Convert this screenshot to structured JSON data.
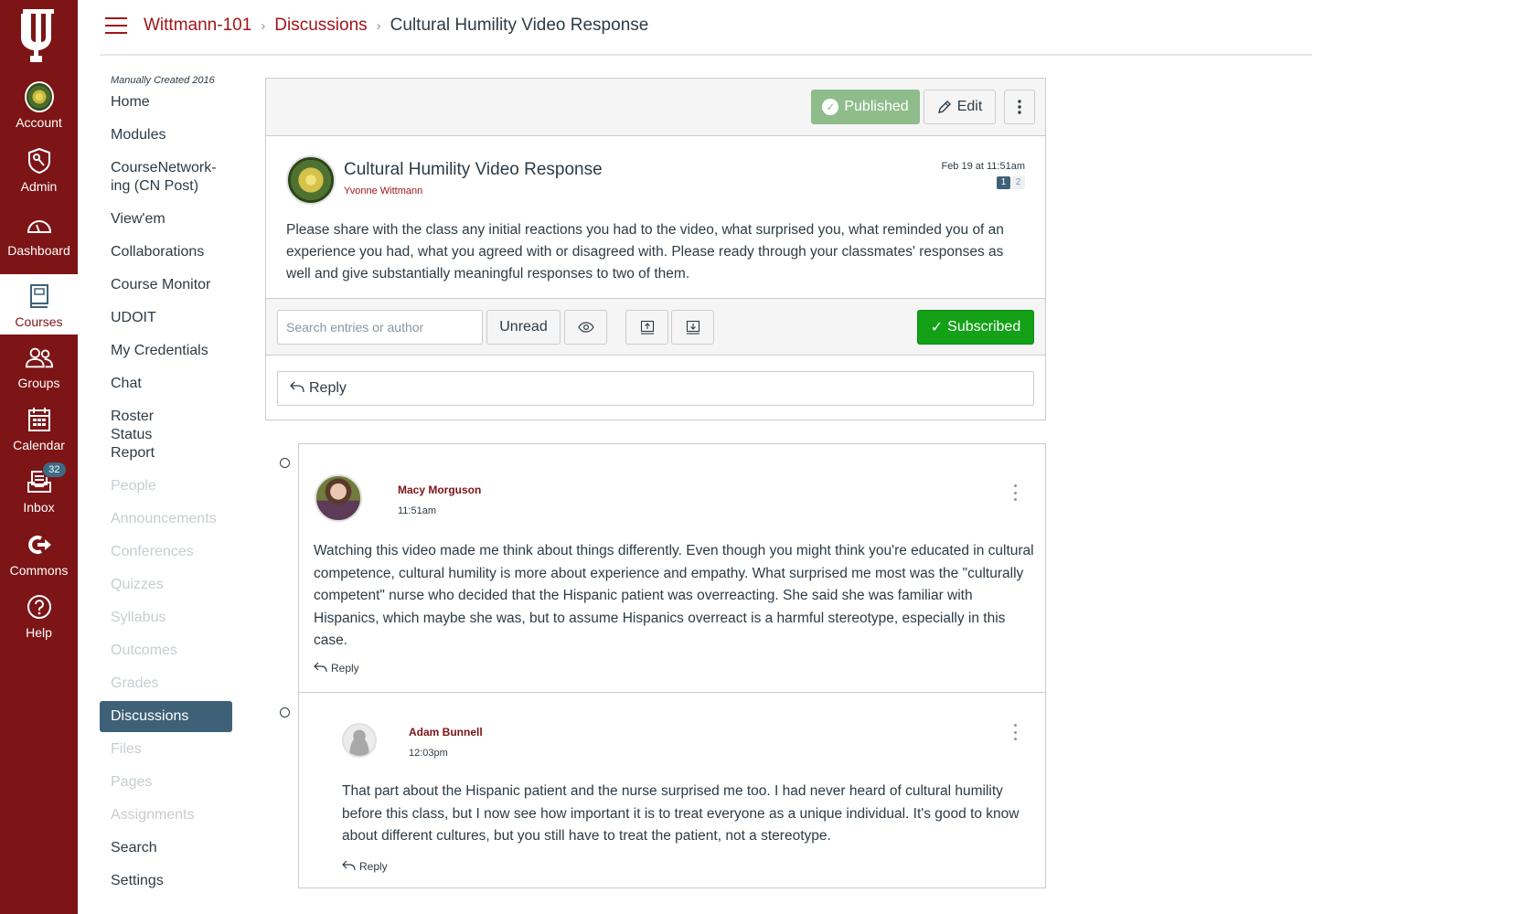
{
  "global_nav": {
    "items": [
      {
        "label": "Account",
        "icon": "account-avatar-icon"
      },
      {
        "label": "Admin",
        "icon": "admin-shield-icon"
      },
      {
        "label": "Dashboard",
        "icon": "dashboard-gauge-icon"
      },
      {
        "label": "Courses",
        "icon": "courses-book-icon",
        "active": true
      },
      {
        "label": "Groups",
        "icon": "groups-icon"
      },
      {
        "label": "Calendar",
        "icon": "calendar-icon"
      },
      {
        "label": "Inbox",
        "icon": "inbox-icon",
        "badge": "32"
      },
      {
        "label": "Commons",
        "icon": "commons-icon"
      },
      {
        "label": "Help",
        "icon": "help-icon"
      }
    ]
  },
  "breadcrumb": {
    "course": "Wittmann-101",
    "section": "Discussions",
    "current": "Cultural Humility Video Response"
  },
  "course_nav": {
    "subtitle": "Manually Created 2016",
    "items": [
      {
        "label": "Home"
      },
      {
        "label": "Modules"
      },
      {
        "label": "CourseNetwork-ing (CN Post)"
      },
      {
        "label": "View'em"
      },
      {
        "label": "Collaborations"
      },
      {
        "label": "Course Monitor"
      },
      {
        "label": "UDOIT"
      },
      {
        "label": "My Credentials"
      },
      {
        "label": "Chat"
      },
      {
        "label": "Roster Status Report"
      },
      {
        "label": "People",
        "disabled": true
      },
      {
        "label": "Announcements",
        "disabled": true
      },
      {
        "label": "Conferences",
        "disabled": true
      },
      {
        "label": "Quizzes",
        "disabled": true
      },
      {
        "label": "Syllabus",
        "disabled": true
      },
      {
        "label": "Outcomes",
        "disabled": true
      },
      {
        "label": "Grades",
        "disabled": true
      },
      {
        "label": "Discussions",
        "active": true
      },
      {
        "label": "Files",
        "disabled": true
      },
      {
        "label": "Pages",
        "disabled": true
      },
      {
        "label": "Assignments",
        "disabled": true
      },
      {
        "label": "Search"
      },
      {
        "label": "Settings"
      }
    ]
  },
  "toolbar": {
    "published_label": "Published",
    "edit_label": "Edit"
  },
  "topic": {
    "title": "Cultural Humility Video Response",
    "author": "Yvonne Wittmann",
    "date": "Feb 19 at 11:51am",
    "pages": [
      "1",
      "2"
    ],
    "body": "Please share with the class any initial reactions you had to the video, what surprised you, what reminded you of an experience you had, what you agreed with or disagreed with. Please ready through your classmates' responses as well and give substantially meaningful responses to two of them."
  },
  "filters": {
    "search_placeholder": "Search entries or author",
    "unread_label": "Unread",
    "subscribed_label": "Subscribed",
    "reply_label": "Reply"
  },
  "entries": [
    {
      "author": "Macy Morguson",
      "time": "11:51am",
      "body": "Watching this video made me think about things differently. Even though you might think you're educated in cultural competence, cultural humility is more about experience and empathy. What surprised me most was the \"culturally competent\" nurse who decided that the Hispanic patient was overreacting. She said she was familiar with Hispanics, which maybe she was, but to assume Hispanics overreact is a harmful stereotype, especially in this case.",
      "reply_label": "Reply"
    },
    {
      "author": "Adam Bunnell",
      "time": "12:03pm",
      "body": "That part about the Hispanic patient and the nurse surprised me too. I had never heard of cultural humility before this class, but I now see how important it is to treat everyone as a unique individual. It's good to know about different cultures, but you still have to treat the patient, not a stereotype.",
      "reply_label": "Reply"
    }
  ],
  "colors": {
    "brand": "#7d1416",
    "link": "#a0161a",
    "published": "#8fbc8b",
    "subscribed": "#13a117",
    "active_nav": "#3e6178"
  }
}
